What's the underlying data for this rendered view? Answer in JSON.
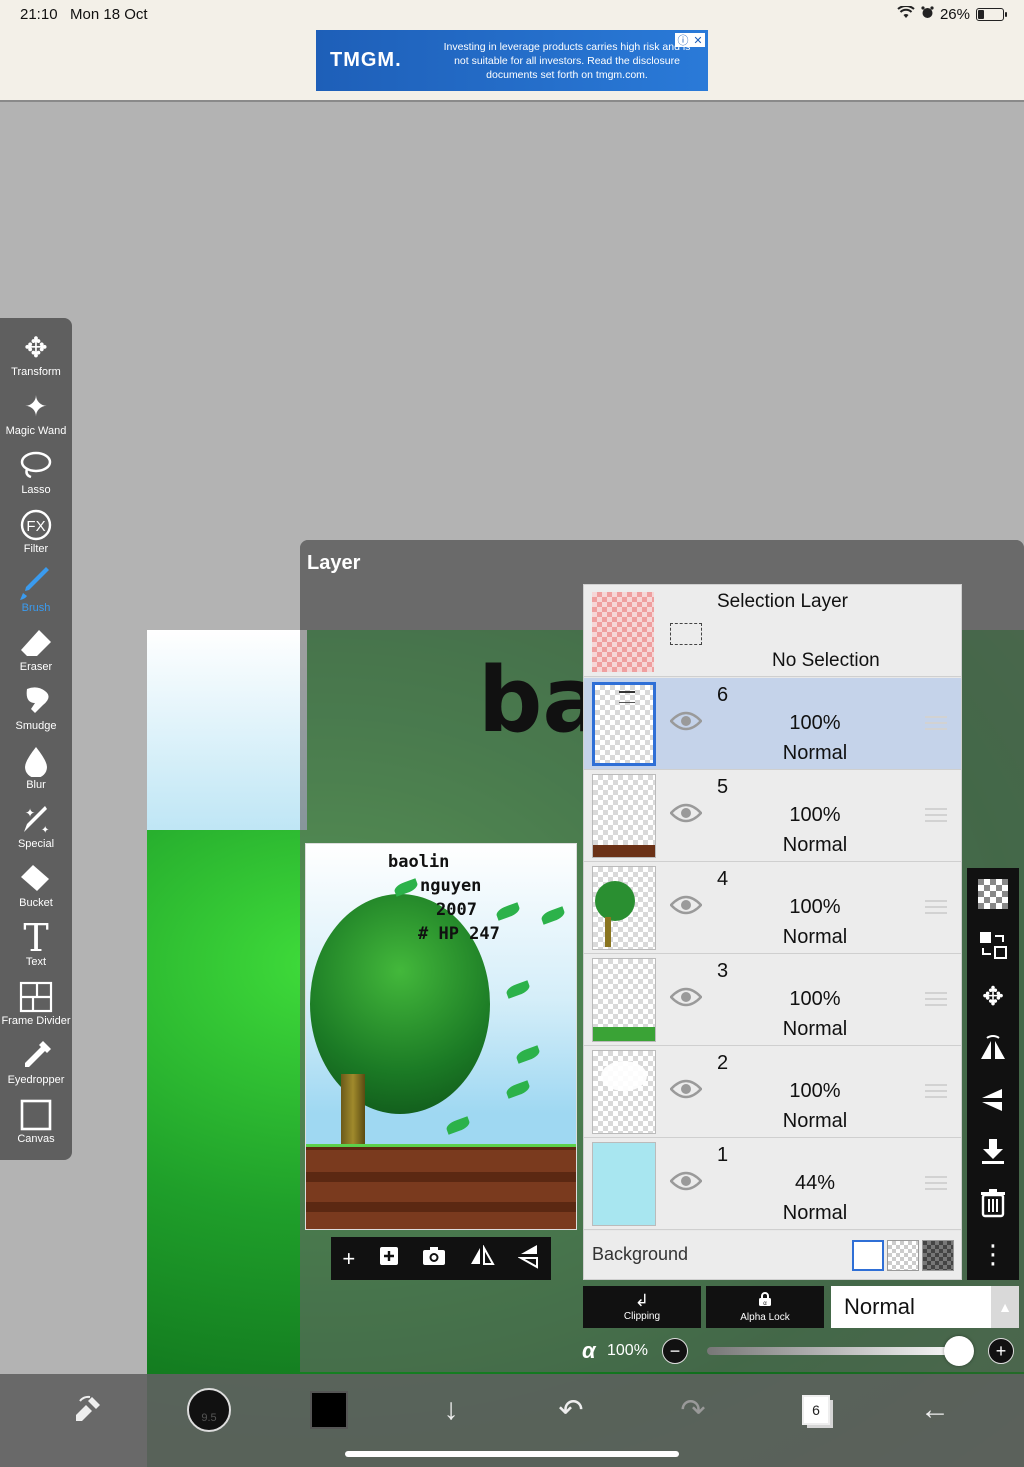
{
  "status_bar": {
    "time": "21:10",
    "date": "Mon 18 Oct",
    "battery": "26%",
    "battery_level": 0.26
  },
  "ad": {
    "brand": "TMGM.",
    "text": "Investing in leverage products carries high risk and is not suitable for all investors. Read the disclosure documents set forth on tmgm.com."
  },
  "toolbar": {
    "items": [
      {
        "label": "Transform",
        "icon": "move-arrows-icon"
      },
      {
        "label": "Magic Wand",
        "icon": "magic-wand-icon"
      },
      {
        "label": "Lasso",
        "icon": "lasso-icon"
      },
      {
        "label": "Filter",
        "icon": "fx-icon"
      },
      {
        "label": "Brush",
        "icon": "brush-icon"
      },
      {
        "label": "Eraser",
        "icon": "eraser-icon"
      },
      {
        "label": "Smudge",
        "icon": "smudge-icon"
      },
      {
        "label": "Blur",
        "icon": "drop-icon"
      },
      {
        "label": "Special",
        "icon": "sparkle-pen-icon"
      },
      {
        "label": "Bucket",
        "icon": "bucket-icon"
      },
      {
        "label": "Text",
        "icon": "text-icon"
      },
      {
        "label": "Frame Divider",
        "icon": "frame-divider-icon"
      },
      {
        "label": "Eyedropper",
        "icon": "eyedropper-icon"
      },
      {
        "label": "Canvas",
        "icon": "canvas-icon"
      }
    ],
    "active": "Brush",
    "active_color": "#3a9bef"
  },
  "canvas": {
    "visible_text": "ba"
  },
  "layer_panel": {
    "title": "Layer",
    "preview": {
      "text_lines": [
        "baolin",
        "nguyen",
        "2007",
        "# HP 247"
      ]
    },
    "selection_layer": {
      "name": "Selection Layer",
      "status": "No Selection"
    },
    "layers": [
      {
        "number": "6",
        "opacity": "100%",
        "blend": "Normal",
        "selected": true
      },
      {
        "number": "5",
        "opacity": "100%",
        "blend": "Normal",
        "selected": false
      },
      {
        "number": "4",
        "opacity": "100%",
        "blend": "Normal",
        "selected": false
      },
      {
        "number": "3",
        "opacity": "100%",
        "blend": "Normal",
        "selected": false
      },
      {
        "number": "2",
        "opacity": "100%",
        "blend": "Normal",
        "selected": false
      },
      {
        "number": "1",
        "opacity": "44%",
        "blend": "Normal",
        "selected": false
      }
    ],
    "background_label": "Background",
    "clipping_label": "Clipping",
    "alpha_lock_label": "Alpha Lock",
    "blend_mode": "Normal",
    "opacity_symbol": "α",
    "opacity_value": "100%",
    "selected_color": "#2f6fd6"
  },
  "bottom_bar": {
    "brush_size": "9.5",
    "layer_count": "6",
    "color": "#000000"
  }
}
